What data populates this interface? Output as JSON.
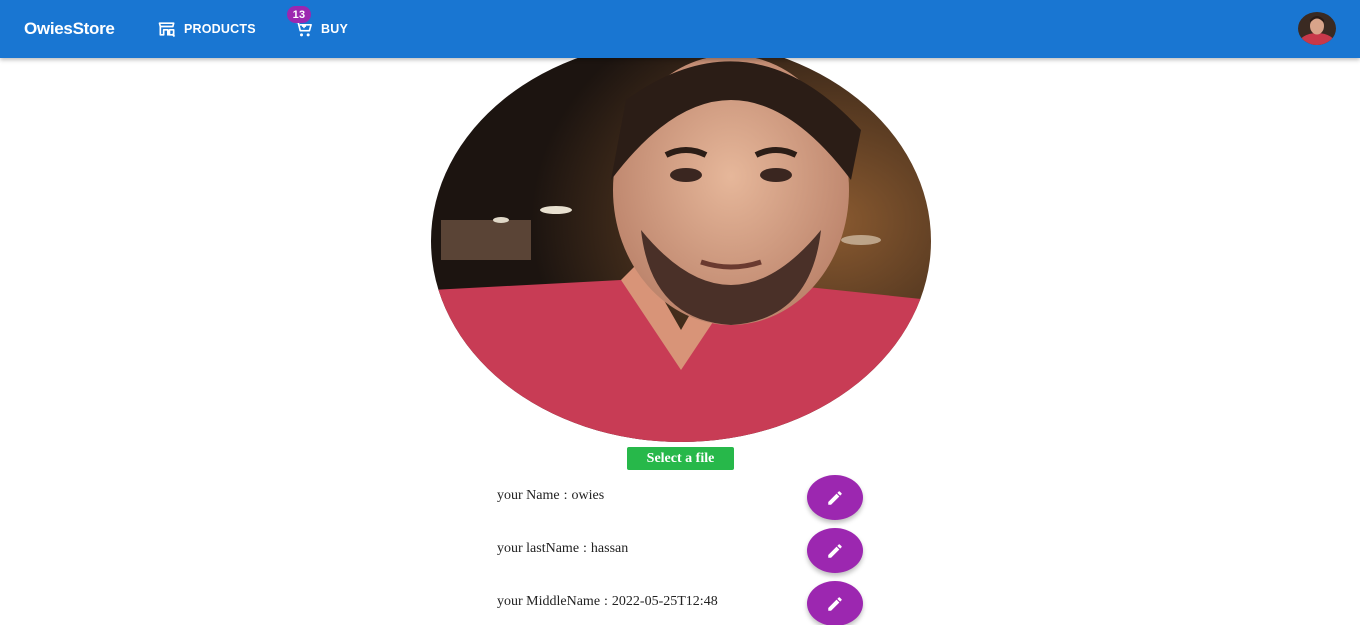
{
  "header": {
    "brand": "OwiesStore",
    "products_label": "PRODUCTS",
    "buy_label": "BUY",
    "cart_badge": "13",
    "colors": {
      "appbar": "#1976d2",
      "badge": "#9c27b0"
    }
  },
  "profile": {
    "photo_icon": "profile-photo",
    "select_file_label": "Select a file",
    "fields": [
      {
        "label": "your Name",
        "value": "owies"
      },
      {
        "label": "your lastName",
        "value": "hassan"
      },
      {
        "label": "your MiddleName",
        "value": "2022-05-25T12:48"
      }
    ],
    "edit_icon": "pencil-icon",
    "colors": {
      "select_button": "#27b84a",
      "edit_button": "#9c27b0"
    }
  }
}
